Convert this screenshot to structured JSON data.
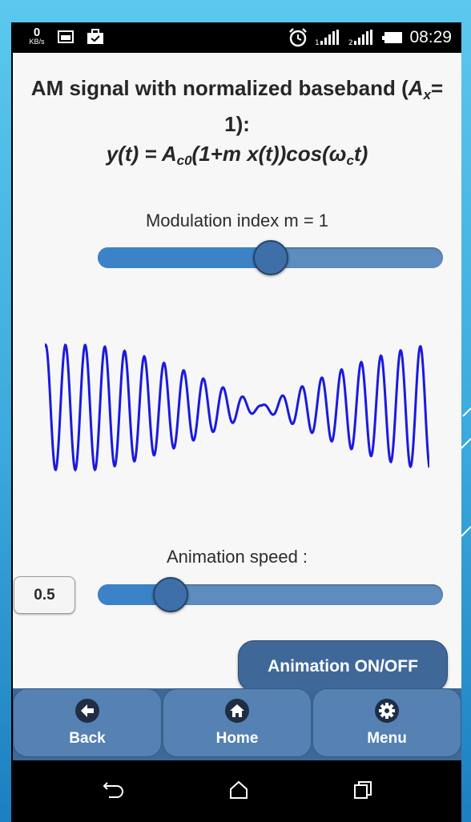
{
  "status_bar": {
    "network_speed_value": "0",
    "network_speed_unit": "KB/s",
    "time": "08:29",
    "icons": [
      "image-icon",
      "briefcase-icon",
      "alarm-icon",
      "signal-icon",
      "signal-2-icon",
      "battery-icon"
    ]
  },
  "title": {
    "line1_text": "AM signal with normalized baseband (",
    "line1_var": "A",
    "line1_sub": "x",
    "line1_eq": "=",
    "line2": "1):",
    "formula_pre": "y(t) = A",
    "formula_sub1": "c0",
    "formula_mid": "(1+m x(t))cos(ω",
    "formula_sub2": "c",
    "formula_post": "t)"
  },
  "modulation": {
    "label": "Modulation index m = 1",
    "value_fraction": 0.5
  },
  "waveform": {
    "color": "#1a1adf",
    "icon": "am-waveform"
  },
  "speed": {
    "label": "Animation speed :",
    "value": "0.5",
    "value_fraction": 0.21
  },
  "animation_button": {
    "label": "Animation ON/OFF"
  },
  "nav": {
    "back": {
      "label": "Back",
      "icon": "arrow-left-icon"
    },
    "home": {
      "label": "Home",
      "icon": "home-icon"
    },
    "menu": {
      "label": "Menu",
      "icon": "gear-icon"
    }
  },
  "system_nav": [
    "back-icon",
    "home-icon",
    "recents-icon"
  ],
  "colors": {
    "slider_fill": "#3b83c6",
    "slider_track": "#5d8cbf",
    "knob": "#3f6fa8",
    "nav_button": "#5581b3",
    "app_bg": "#f7f7f7"
  }
}
